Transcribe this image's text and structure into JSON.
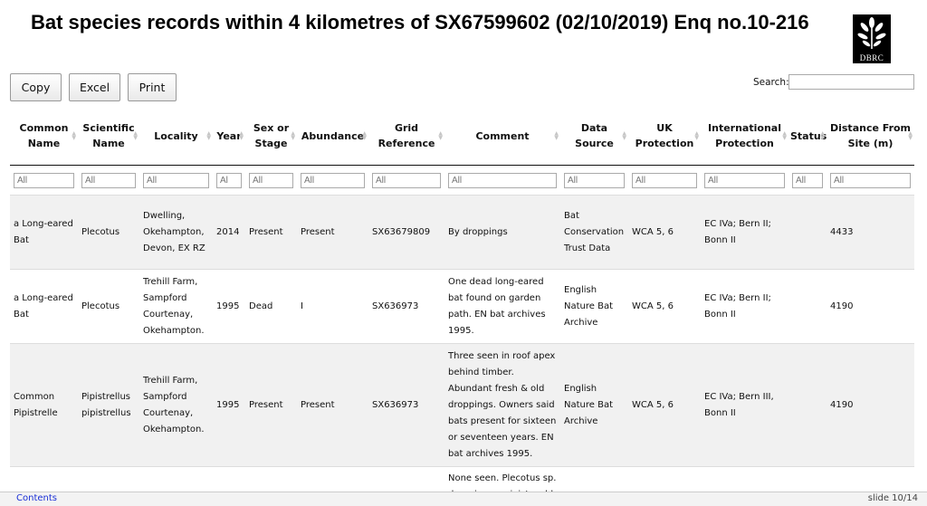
{
  "page": {
    "title": "Bat species records within 4 kilometres of SX67599602 (02/10/2019) Enq no.10-216",
    "logo_text": "DBRC"
  },
  "toolbar": {
    "copy_label": "Copy",
    "excel_label": "Excel",
    "print_label": "Print"
  },
  "search": {
    "label": "Search:",
    "value": ""
  },
  "table": {
    "headers": [
      "Common Name",
      "Scientific Name",
      "Locality",
      "Year",
      "Sex or Stage",
      "Abundance",
      "Grid Reference",
      "Comment",
      "Data Source",
      "UK Protection",
      "International Protection",
      "Status",
      "Distance From Site (m)"
    ],
    "filter_placeholders": [
      "All",
      "All",
      "All",
      "Al",
      "All",
      "All",
      "All",
      "All",
      "All",
      "All",
      "All",
      "All",
      "All"
    ],
    "rows": [
      [
        "a Long-eared Bat",
        "Plecotus",
        "Dwelling, Okehampton, Devon, EX RZ",
        "2014",
        "Present",
        "Present",
        "SX63679809",
        "By droppings",
        "Bat Conservation Trust Data",
        "WCA 5, 6",
        "EC IVa; Bern II; Bonn II",
        "",
        "4433"
      ],
      [
        "a Long-eared Bat",
        "Plecotus",
        "Trehill Farm, Sampford Courtenay, Okehampton.",
        "1995",
        "Dead",
        "I",
        "SX636973",
        "One dead long-eared bat found on garden path. EN bat archives 1995.",
        "English Nature Bat Archive",
        "WCA 5, 6",
        "EC IVa; Bern II; Bonn II",
        "",
        "4190"
      ],
      [
        "Common Pipistrelle",
        "Pipistrellus pipistrellus",
        "Trehill Farm, Sampford Courtenay, Okehampton.",
        "1995",
        "Present",
        "Present",
        "SX636973",
        "Three seen in roof apex behind timber. Abundant fresh & old droppings. Owners said bats present for sixteen or seventeen years. EN bat archives 1995.",
        "English Nature Bat Archive",
        "WCA 5, 6",
        "EC IVa; Bern III, Bonn II",
        "",
        "4190"
      ],
      [
        "",
        "",
        "",
        "",
        "",
        "",
        "",
        "None seen. Plecotus sp. droppings on joists, old",
        "",
        "",
        "",
        "",
        ""
      ]
    ]
  },
  "footer": {
    "contents_label": "Contents",
    "slide_label": "slide 10/14"
  }
}
